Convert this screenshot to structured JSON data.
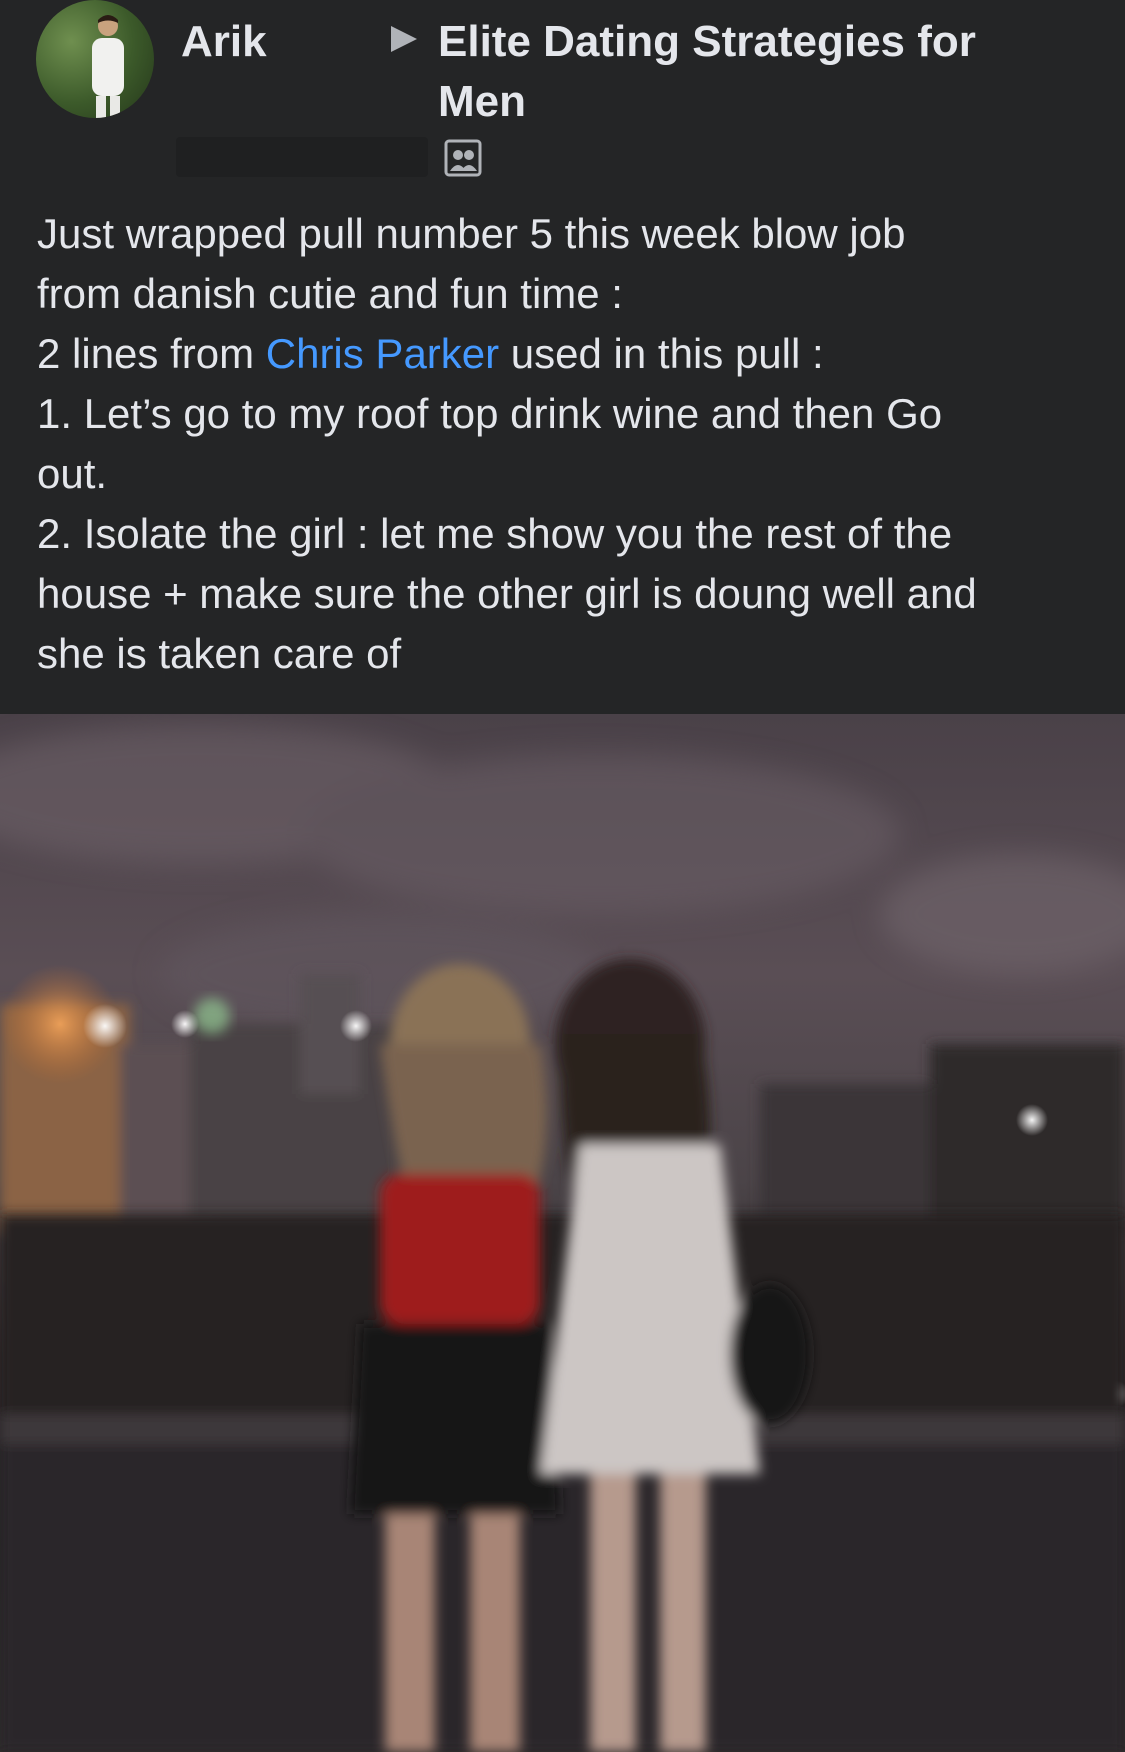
{
  "header": {
    "author_name": "Arik",
    "group_name": "Elite Dating Strategies for Men",
    "arrow_icon": "triangle-right-icon",
    "audience_icon": "group-audience-icon"
  },
  "post": {
    "line1": "Just wrapped pull number 5 this week blow job",
    "line2": "from danish cutie and fun time :",
    "line3_before": "2 lines from ",
    "line3_mention": "Chris Parker",
    "line3_after": " used in this pull :",
    "line4": "1. Let’s go to my roof top drink wine and then Go",
    "line5": "out.",
    "line6": "2. Isolate the girl : let me show you the rest of the",
    "line7": "house + make sure the other girl is doung well and",
    "line8": "she is taken care of"
  },
  "colors": {
    "background": "#242526",
    "text": "#e4e6eb",
    "mention": "#4599ff"
  }
}
